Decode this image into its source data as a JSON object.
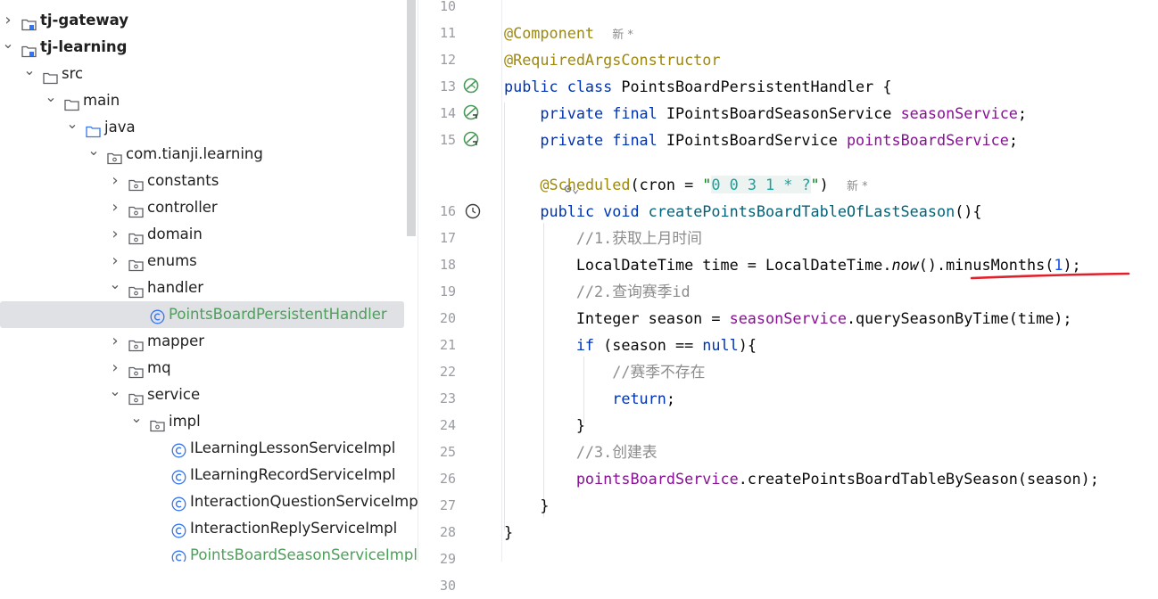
{
  "tree": {
    "items": [
      {
        "label": "tj-gateway",
        "bold": true,
        "chevron": "chevron-right",
        "icon": "module-folder-icon",
        "indent": 0
      },
      {
        "label": "tj-learning",
        "bold": true,
        "chevron": "chevron-down",
        "icon": "module-folder-icon",
        "indent": 0
      },
      {
        "label": "src",
        "chevron": "chevron-down",
        "icon": "folder-icon",
        "indent": 1
      },
      {
        "label": "main",
        "chevron": "chevron-down",
        "icon": "folder-icon",
        "indent": 2
      },
      {
        "label": "java",
        "chevron": "chevron-down",
        "icon": "source-folder-icon",
        "indent": 3
      },
      {
        "label": "com.tianji.learning",
        "chevron": "chevron-down",
        "icon": "package-icon",
        "indent": 4
      },
      {
        "label": "constants",
        "chevron": "chevron-right",
        "icon": "package-icon",
        "indent": 5
      },
      {
        "label": "controller",
        "chevron": "chevron-right",
        "icon": "package-icon",
        "indent": 5
      },
      {
        "label": "domain",
        "chevron": "chevron-right",
        "icon": "package-icon",
        "indent": 5
      },
      {
        "label": "enums",
        "chevron": "chevron-right",
        "icon": "package-icon",
        "indent": 5
      },
      {
        "label": "handler",
        "chevron": "chevron-down",
        "icon": "package-icon",
        "indent": 5
      },
      {
        "label": "PointsBoardPersistentHandler",
        "chevron": "",
        "icon": "class-icon",
        "indent": 6,
        "selected": true,
        "green": true
      },
      {
        "label": "mapper",
        "chevron": "chevron-right",
        "icon": "package-icon",
        "indent": 5
      },
      {
        "label": "mq",
        "chevron": "chevron-right",
        "icon": "package-icon",
        "indent": 5
      },
      {
        "label": "service",
        "chevron": "chevron-down",
        "icon": "package-icon",
        "indent": 5
      },
      {
        "label": "impl",
        "chevron": "chevron-down",
        "icon": "package-icon",
        "indent": 6
      },
      {
        "label": "ILearningLessonServiceImpl",
        "chevron": "",
        "icon": "class-icon",
        "indent": 7
      },
      {
        "label": "ILearningRecordServiceImpl",
        "chevron": "",
        "icon": "class-icon",
        "indent": 7
      },
      {
        "label": "InteractionQuestionServiceImpl",
        "chevron": "",
        "icon": "class-icon",
        "indent": 7
      },
      {
        "label": "InteractionReplyServiceImpl",
        "chevron": "",
        "icon": "class-icon",
        "indent": 7
      },
      {
        "label": "PointsBoardSeasonServiceImpl",
        "chevron": "",
        "icon": "class-icon",
        "indent": 7,
        "green": true
      }
    ]
  },
  "editor": {
    "line_numbers": [
      "10",
      "11",
      "12",
      "13",
      "14",
      "15",
      "",
      "16",
      "17",
      "18",
      "19",
      "20",
      "21",
      "22",
      "23",
      "24",
      "25",
      "26",
      "27",
      "28",
      "29",
      "30"
    ],
    "hints": {
      "new_marker": "新 *"
    },
    "code": {
      "l11_ann": "@Component",
      "l12_ann": "@RequiredArgsConstructor",
      "l13_kw": "public class ",
      "l13_name": "PointsBoardPersistentHandler {",
      "l14_kw": "private final ",
      "l14_type": "IPointsBoardSeasonService ",
      "l14_fld": "seasonService",
      "l14_end": ";",
      "l15_kw": "private final ",
      "l15_type": "IPointsBoardService ",
      "l15_fld": "pointsBoardService",
      "l15_end": ";",
      "l16_ann": "@Scheduled",
      "l16_a": "(cron = ",
      "l16_q1": "\"",
      "l16_cron": "0 0 3 1 * ?",
      "l16_q2": "\"",
      "l16_b": ")",
      "l17_kw": "public void ",
      "l17_mth": "createPointsBoardTableOfLastSeason",
      "l17_end": "(){",
      "l18_cmt": "//1.获取上月时间",
      "l19_a": "LocalDateTime time = LocalDateTime.",
      "l19_now": "now",
      "l19_b": "().minusMonths(",
      "l19_num": "1",
      "l19_c": ");",
      "l20_cmt": "//2.查询赛季id",
      "l21_a": "Integer season = ",
      "l21_fld": "seasonService",
      "l21_b": ".querySeasonByTime(time);",
      "l22_kw": "if",
      "l22_a": " (season == ",
      "l22_null": "null",
      "l22_b": "){",
      "l23_cmt": "//赛季不存在",
      "l24_kw": "return",
      "l24_end": ";",
      "l25": "}",
      "l26_cmt": "//3.创建表",
      "l27_fld": "pointsBoardService",
      "l27_b": ".createPointsBoardTableBySeason(season);",
      "l28": "}",
      "l29": "}"
    }
  },
  "colors": {
    "keyword": "#0033b3",
    "annotation": "#9e880d",
    "field": "#871094",
    "method": "#00627a",
    "comment": "#8c8c8c",
    "class_green": "#4d9f5a",
    "annotation_underline": "#e0202a"
  }
}
